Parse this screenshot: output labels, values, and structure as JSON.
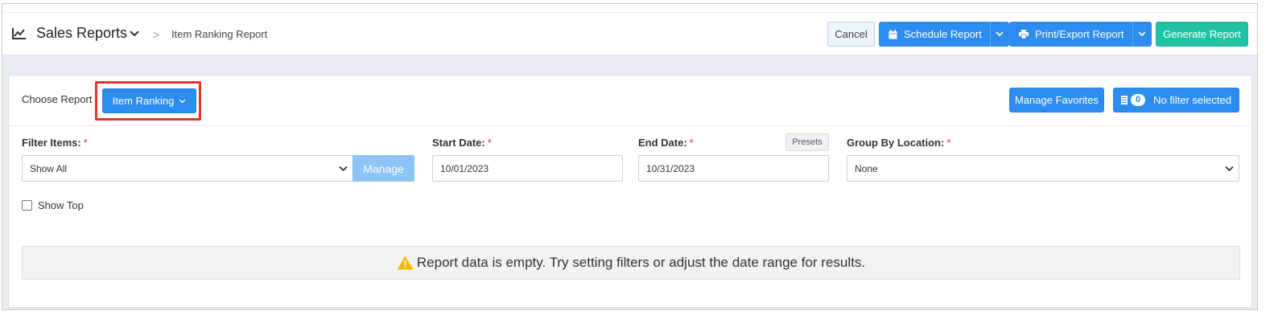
{
  "header": {
    "title": "Sales Reports",
    "breadcrumb_separator": ">",
    "breadcrumb_current": "Item Ranking Report",
    "cancel_label": "Cancel",
    "schedule_label": "Schedule Report",
    "print_label": "Print/Export Report",
    "generate_label": "Generate Report"
  },
  "report_chooser": {
    "label": "Choose Report",
    "selected": "Item Ranking",
    "manage_favorites_label": "Manage Favorites",
    "filter_count": "0",
    "filter_status": "No filter selected"
  },
  "filters": {
    "filter_items_label": "Filter Items:",
    "filter_items_value": "Show All",
    "manage_label": "Manage",
    "start_date_label": "Start Date:",
    "start_date_value": "10/01/2023",
    "end_date_label": "End Date:",
    "end_date_value": "10/31/2023",
    "presets_label": "Presets",
    "group_by_label": "Group By Location:",
    "group_by_value": "None",
    "required_mark": "*",
    "show_top_label": "Show Top"
  },
  "message": {
    "empty_text": "Report data is empty. Try setting filters or adjust the date range for results."
  },
  "colors": {
    "primary": "#2d8cf0",
    "success": "#21c2a2",
    "highlight": "#e5322d",
    "warning": "#f5b800"
  },
  "icons": [
    "chart-line-icon",
    "chevron-down-icon",
    "calendar-icon",
    "printer-icon",
    "filter-list-icon",
    "warning-icon"
  ]
}
